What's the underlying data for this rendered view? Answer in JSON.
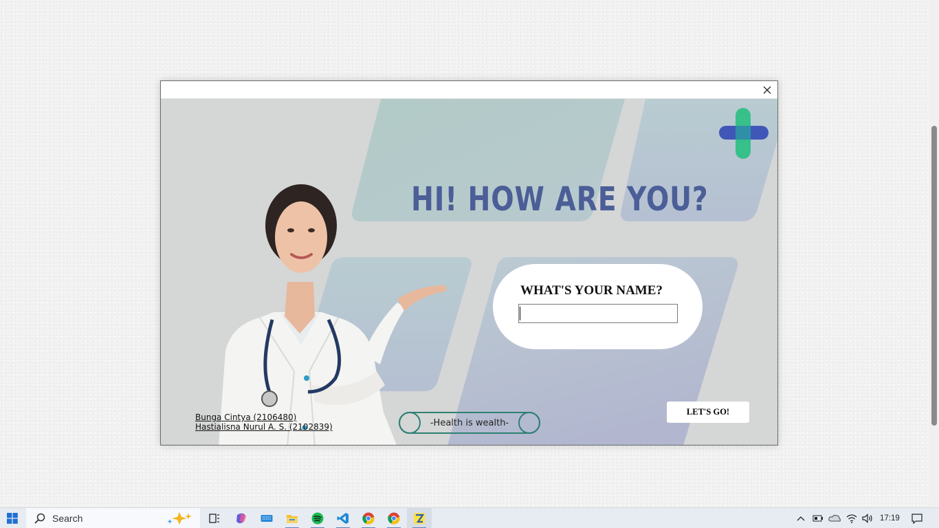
{
  "dialog": {
    "headline": "HI! HOW ARE YOU?",
    "name_prompt": "WHAT'S YOUR NAME?",
    "name_value": "",
    "go_button": "LET'S GO!",
    "motto": "-Health is wealth-",
    "credits": [
      "Bunga Cintya (2106480)",
      "Hastialisna Nurul A. S. (2102839)"
    ]
  },
  "taskbar": {
    "search_placeholder": "Search",
    "clock": "17:19",
    "icons": [
      "windows-start-icon",
      "search-icon",
      "copilot-sparkle-icon",
      "task-view-icon",
      "copilot-icon",
      "keyboard-icon",
      "file-explorer-icon",
      "spotify-icon",
      "vscode-icon",
      "chrome-icon",
      "chrome-icon",
      "python-app-icon",
      "chevron-up-icon",
      "battery-icon",
      "onedrive-icon",
      "wifi-icon",
      "volume-icon",
      "notification-icon"
    ]
  },
  "colors": {
    "headline": "#4b5e97",
    "logo_green": "#37c08a",
    "logo_blue": "#4057b8",
    "motto_border": "#2e7f72"
  }
}
